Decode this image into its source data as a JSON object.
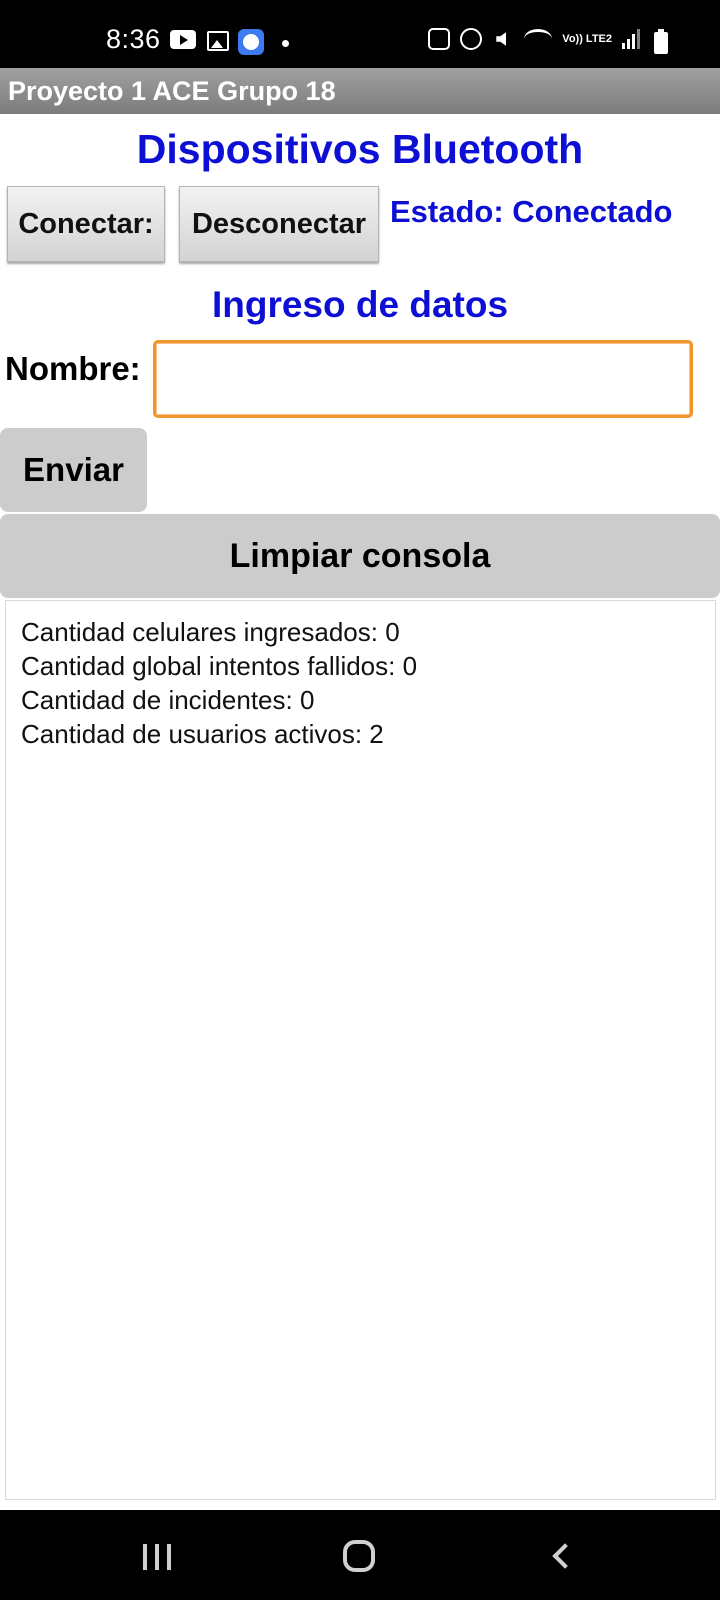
{
  "status_bar": {
    "time": "8:36",
    "network_label": "Vo)) LTE2",
    "icons": [
      "youtube-icon",
      "gallery-icon",
      "messenger-icon",
      "dot-icon",
      "recycle-icon",
      "alarm-icon",
      "mute-icon",
      "wifi-icon",
      "signal-icon",
      "battery-icon"
    ]
  },
  "app": {
    "title": "Proyecto 1 ACE Grupo 18"
  },
  "bluetooth": {
    "heading": "Dispositivos Bluetooth",
    "connect_label": "Conectar:",
    "disconnect_label": "Desconectar",
    "status_text": "Estado: Conectado"
  },
  "form": {
    "heading": "Ingreso de datos",
    "name_label": "Nombre:",
    "name_value": "",
    "send_label": "Enviar",
    "clear_label": "Limpiar consola"
  },
  "console": {
    "lines": [
      "Cantidad celulares ingresados: 0",
      "Cantidad global intentos fallidos: 0",
      "Cantidad de incidentes: 0",
      "Cantidad de usuarios activos: 2"
    ]
  },
  "nav_bar": {
    "icons": [
      "recents-icon",
      "home-icon",
      "back-icon"
    ]
  },
  "colors": {
    "accent_blue": "#0d10d4",
    "input_focus": "#f0952a",
    "flat_button": "#cccccc"
  }
}
